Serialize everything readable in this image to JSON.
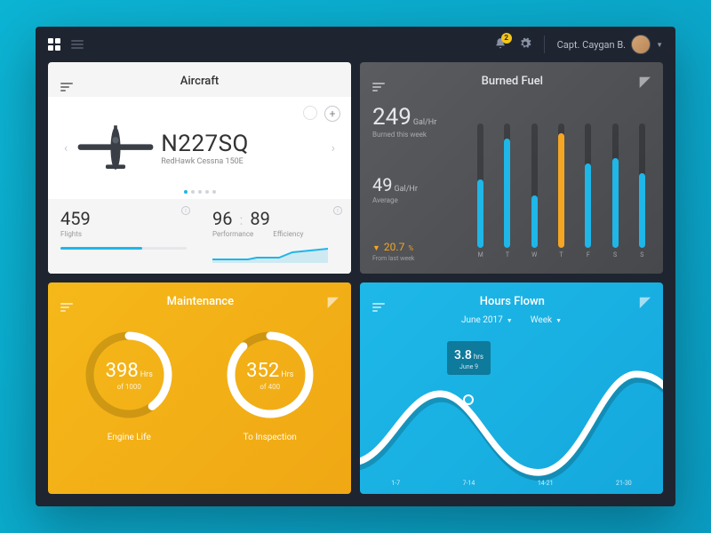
{
  "topbar": {
    "notifications": "2",
    "user": "Capt. Caygan B."
  },
  "aircraft": {
    "title": "Aircraft",
    "reg": "N227SQ",
    "model": "RedHawk Cessna 150E",
    "flights": {
      "value": "459",
      "label": "Flights",
      "pct": 65
    },
    "perf": {
      "value": "96",
      "label": "Performance"
    },
    "eff": {
      "value": "89",
      "label": "Efficiency"
    }
  },
  "fuel": {
    "title": "Burned Fuel",
    "burned": {
      "value": "249",
      "unit": "Gal/Hr",
      "label": "Burned this week"
    },
    "avg": {
      "value": "49",
      "unit": "Gal/Hr",
      "label": "Average"
    },
    "delta": {
      "value": "20.7",
      "pct": "%",
      "label": "From last week"
    },
    "days": [
      "M",
      "T",
      "W",
      "T",
      "F",
      "S",
      "S"
    ]
  },
  "maint": {
    "title": "Maintenance",
    "engine": {
      "value": "398",
      "unit": "Hrs",
      "of": "of 1000",
      "label": "Engine Life",
      "pct": 39.8
    },
    "insp": {
      "value": "352",
      "unit": "Hrs",
      "of": "of 400",
      "label": "To Inspection",
      "pct": 88
    }
  },
  "hours": {
    "title": "Hours Flown",
    "period": "June 2017",
    "range": "Week",
    "point": {
      "value": "3.8",
      "unit": "hrs",
      "date": "June 9"
    },
    "axis": [
      "1-7",
      "7-14",
      "14-21",
      "21-30"
    ]
  },
  "chart_data": [
    {
      "type": "bar",
      "title": "Burned Fuel",
      "categories": [
        "M",
        "T",
        "W",
        "T",
        "F",
        "S",
        "S"
      ],
      "values": [
        55,
        88,
        42,
        92,
        68,
        72,
        60
      ],
      "highlight_index": 3,
      "ylim": [
        0,
        100
      ]
    },
    {
      "type": "line",
      "title": "Hours Flown",
      "categories": [
        "1-7",
        "7-14",
        "14-21",
        "21-30"
      ],
      "values": [
        3.2,
        4.5,
        2.6,
        4.8
      ],
      "marker": {
        "x": "June 9",
        "y": 3.8
      },
      "ylim": [
        0,
        6
      ]
    }
  ]
}
